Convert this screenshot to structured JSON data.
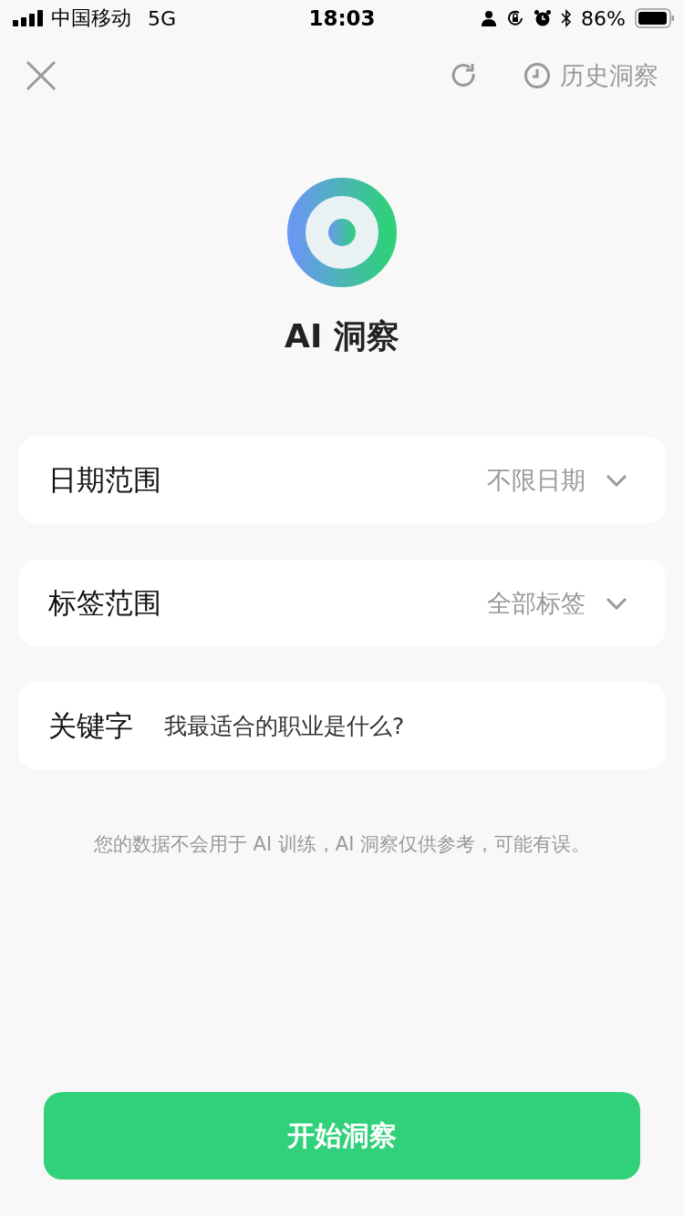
{
  "status_bar": {
    "carrier": "中国移动",
    "network": "5G",
    "time": "18:03",
    "battery": "86%"
  },
  "nav": {
    "history_label": "历史洞察"
  },
  "header": {
    "title": "AI 洞察"
  },
  "fields": [
    {
      "kind": "select",
      "label": "日期范围",
      "value": "不限日期"
    },
    {
      "kind": "select",
      "label": "标签范围",
      "value": "全部标签"
    },
    {
      "kind": "input",
      "label": "关键字",
      "value": "我最适合的职业是什么?"
    }
  ],
  "disclaimer": "您的数据不会用于 AI 训练，AI 洞察仅供参考，可能有误。",
  "start_button": "开始洞察"
}
